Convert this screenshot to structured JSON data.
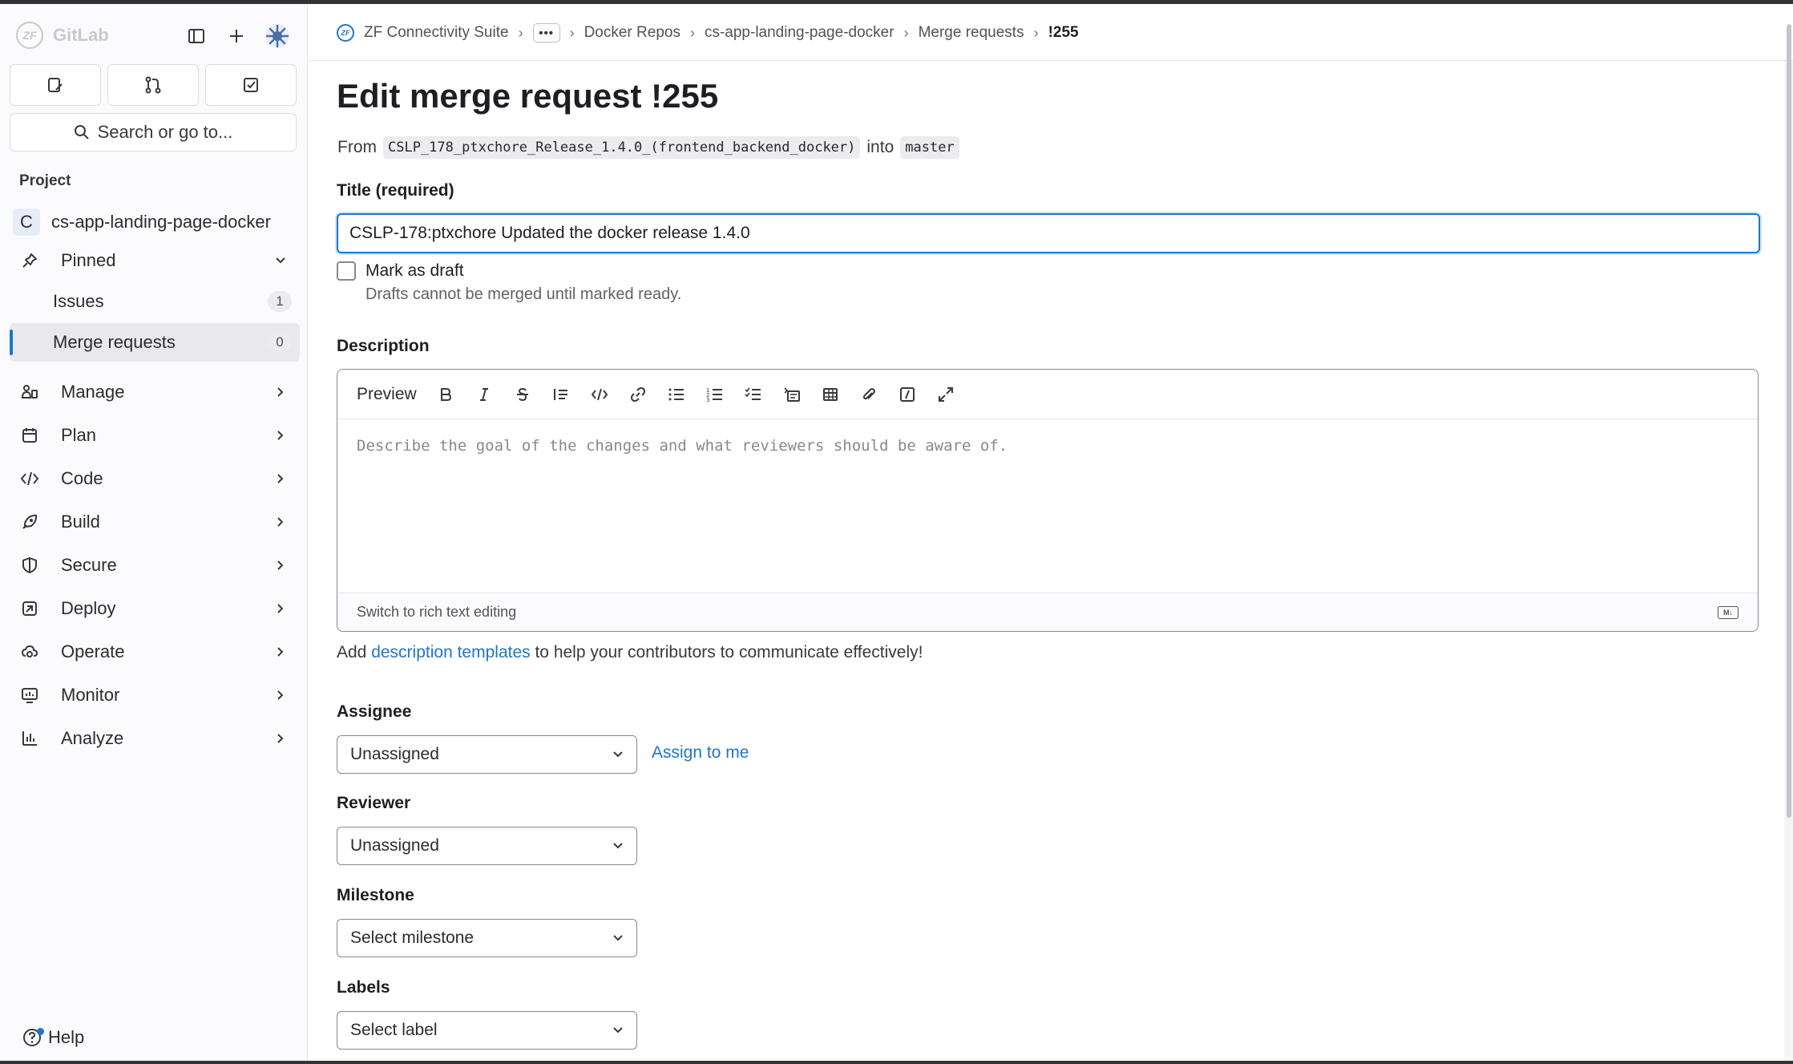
{
  "app": {
    "name": "GitLab"
  },
  "sidebar": {
    "search_label": "Search or go to...",
    "section_label": "Project",
    "project": {
      "avatar_letter": "C",
      "name": "cs-app-landing-page-docker"
    },
    "pinned_label": "Pinned",
    "pinned_items": [
      {
        "label": "Issues",
        "count": "1"
      },
      {
        "label": "Merge requests",
        "count": "0"
      }
    ],
    "nav_items": [
      {
        "label": "Manage",
        "icon": "manage-icon"
      },
      {
        "label": "Plan",
        "icon": "plan-icon"
      },
      {
        "label": "Code",
        "icon": "code-icon"
      },
      {
        "label": "Build",
        "icon": "build-icon"
      },
      {
        "label": "Secure",
        "icon": "shield-icon"
      },
      {
        "label": "Deploy",
        "icon": "deploy-icon"
      },
      {
        "label": "Operate",
        "icon": "operate-icon"
      },
      {
        "label": "Monitor",
        "icon": "monitor-icon"
      },
      {
        "label": "Analyze",
        "icon": "analyze-icon"
      }
    ],
    "help_label": "Help"
  },
  "breadcrumb": {
    "items": [
      "ZF Connectivity Suite",
      "Docker Repos",
      "cs-app-landing-page-docker",
      "Merge requests",
      "!255"
    ]
  },
  "page": {
    "title": "Edit merge request !255",
    "from_label": "From",
    "source_branch": "CSLP_178_ptxchore_Release_1.4.0_(frontend_backend_docker)",
    "into_label": "into",
    "target_branch": "master"
  },
  "form": {
    "title_label": "Title (required)",
    "title_value": "CSLP-178:ptxchore Updated the docker release 1.4.0",
    "draft_label": "Mark as draft",
    "draft_help": "Drafts cannot be merged until marked ready.",
    "description_label": "Description",
    "editor": {
      "preview_label": "Preview",
      "placeholder": "Describe the goal of the changes and what reviewers should be aware of.",
      "switch_label": "Switch to rich text editing",
      "markdown_badge": "M↓"
    },
    "desc_help_prefix": "Add ",
    "desc_help_link": "description templates",
    "desc_help_suffix": " to help your contributors to communicate effectively!",
    "assignee_label": "Assignee",
    "assignee_value": "Unassigned",
    "assign_to_me": "Assign to me",
    "reviewer_label": "Reviewer",
    "reviewer_value": "Unassigned",
    "milestone_label": "Milestone",
    "milestone_value": "Select milestone",
    "labels_label": "Labels",
    "labels_value": "Select label"
  },
  "colors": {
    "accent": "#1f75cb",
    "text": "#1f1e24",
    "sidebar_bg": "#fbfafd"
  }
}
